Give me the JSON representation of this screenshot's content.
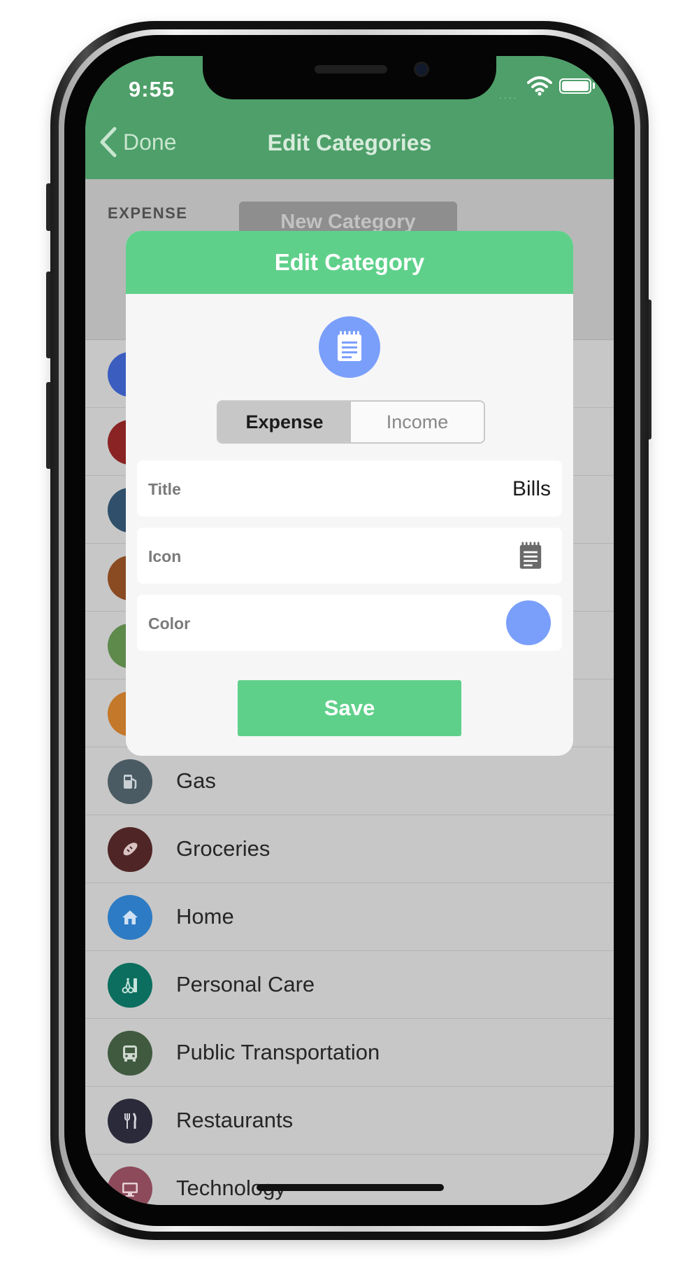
{
  "status_bar": {
    "time": "9:55",
    "signal": "....",
    "wifi_icon": "wifi-icon",
    "battery_icon": "battery-icon"
  },
  "nav": {
    "back_label": "Done",
    "back_icon": "chevron-left-icon",
    "title": "Edit Categories"
  },
  "section": {
    "label": "EXPENSE",
    "new_category_label": "New Category"
  },
  "categories": [
    {
      "label": "",
      "color": "#3a5dbf",
      "icon": "category-icon"
    },
    {
      "label": "",
      "color": "#8a2323",
      "icon": "category-icon"
    },
    {
      "label": "",
      "color": "#2f4f6a",
      "icon": "category-icon"
    },
    {
      "label": "",
      "color": "#8a4a22",
      "icon": "category-icon"
    },
    {
      "label": "",
      "color": "#5e8a4c",
      "icon": "category-icon"
    },
    {
      "label": "",
      "color": "#c3782a",
      "icon": "category-icon"
    },
    {
      "label": "Gas",
      "color": "#4a5b63",
      "icon": "fuel-pump-icon"
    },
    {
      "label": "Groceries",
      "color": "#4f2526",
      "icon": "bread-icon"
    },
    {
      "label": "Home",
      "color": "#2d7bc4",
      "icon": "house-icon"
    },
    {
      "label": "Personal Care",
      "color": "#0b6e5e",
      "icon": "scissors-icon"
    },
    {
      "label": "Public Transportation",
      "color": "#405a40",
      "icon": "bus-icon"
    },
    {
      "label": "Restaurants",
      "color": "#2a2a3a",
      "icon": "fork-knife-icon"
    },
    {
      "label": "Technology",
      "color": "#8c4a5b",
      "icon": "monitor-icon"
    }
  ],
  "modal": {
    "title": "Edit Category",
    "preview_icon": "notepad-icon",
    "preview_color": "#7a9ffb",
    "segments": [
      {
        "label": "Expense",
        "selected": true
      },
      {
        "label": "Income",
        "selected": false
      }
    ],
    "fields": {
      "title": {
        "label": "Title",
        "value": "Bills"
      },
      "icon": {
        "label": "Icon",
        "value_icon": "notepad-icon"
      },
      "color": {
        "label": "Color",
        "value": "#7a9ffb"
      }
    },
    "save_label": "Save"
  },
  "colors": {
    "header_green": "#4e9f69",
    "accent_green": "#5fd08a",
    "modal_bg": "#f6f6f6"
  }
}
